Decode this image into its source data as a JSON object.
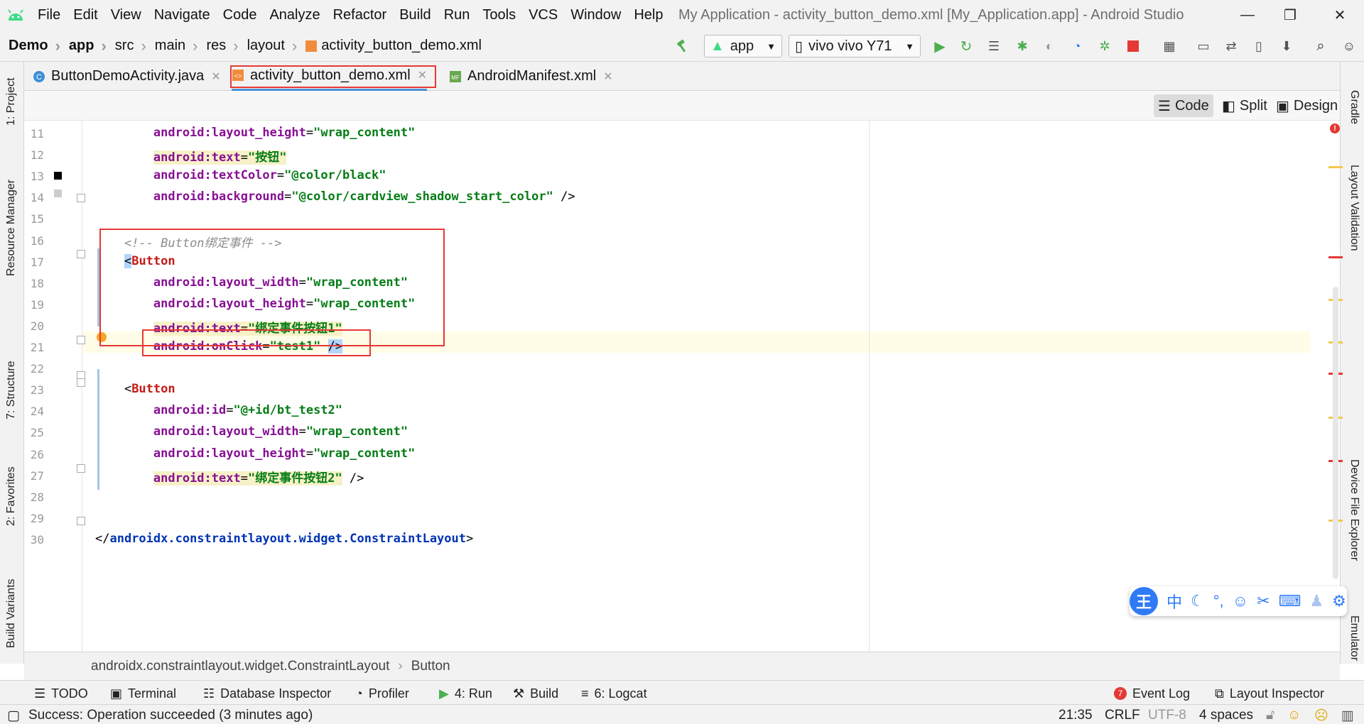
{
  "window": {
    "title": "My Application - activity_button_demo.xml [My_Application.app] - Android Studio"
  },
  "menu": [
    "File",
    "Edit",
    "View",
    "Navigate",
    "Code",
    "Analyze",
    "Refactor",
    "Build",
    "Run",
    "Tools",
    "VCS",
    "Window",
    "Help"
  ],
  "breadcrumb": [
    "Demo",
    "app",
    "src",
    "main",
    "res",
    "layout",
    "activity_button_demo.xml"
  ],
  "run_config": {
    "module": "app",
    "device": "vivo vivo Y71"
  },
  "tabs": [
    {
      "label": "ButtonDemoActivity.java",
      "active": false
    },
    {
      "label": "activity_button_demo.xml",
      "active": true
    },
    {
      "label": "AndroidManifest.xml",
      "active": false
    }
  ],
  "view_modes": [
    "Code",
    "Split",
    "Design"
  ],
  "left_tools": [
    "1: Project",
    "Resource Manager",
    "7: Structure",
    "2: Favorites",
    "Build Variants"
  ],
  "right_tools": [
    "Gradle",
    "Layout Validation",
    "Device File Explorer",
    "Emulator"
  ],
  "code": {
    "lines": [
      {
        "n": "11",
        "tokens": [
          [
            "",
            "        "
          ],
          [
            "attr",
            "android:layout_height"
          ],
          [
            "",
            "="
          ],
          [
            "val",
            "\"wrap_content\""
          ]
        ]
      },
      {
        "n": "12",
        "tokens": [
          [
            "",
            "        "
          ],
          [
            "attr hl-val",
            "android:text"
          ],
          [
            "hl-val",
            "="
          ],
          [
            "val hl-val",
            "\"按钮\""
          ]
        ]
      },
      {
        "n": "13",
        "tokens": [
          [
            "",
            "        "
          ],
          [
            "attr",
            "android:textColor"
          ],
          [
            "",
            "="
          ],
          [
            "val",
            "\"@color/black\""
          ]
        ]
      },
      {
        "n": "14",
        "tokens": [
          [
            "",
            "        "
          ],
          [
            "attr",
            "android:background"
          ],
          [
            "",
            "="
          ],
          [
            "val",
            "\"@color/cardview_shadow_start_color\""
          ],
          [
            "",
            " />"
          ]
        ]
      },
      {
        "n": "15",
        "tokens": []
      },
      {
        "n": "16",
        "tokens": [
          [
            "",
            "    "
          ],
          [
            "cmt",
            "<!-- Button绑定事件 -->"
          ]
        ]
      },
      {
        "n": "17",
        "tokens": [
          [
            "",
            "    "
          ],
          [
            "caret-hl",
            "<"
          ],
          [
            "tag",
            "Button"
          ]
        ]
      },
      {
        "n": "18",
        "tokens": [
          [
            "",
            "        "
          ],
          [
            "attr",
            "android:layout_width"
          ],
          [
            "",
            "="
          ],
          [
            "val",
            "\"wrap_content\""
          ]
        ]
      },
      {
        "n": "19",
        "tokens": [
          [
            "",
            "        "
          ],
          [
            "attr",
            "android:layout_height"
          ],
          [
            "",
            "="
          ],
          [
            "val",
            "\"wrap_content\""
          ]
        ]
      },
      {
        "n": "20",
        "tokens": [
          [
            "",
            "        "
          ],
          [
            "attr hl-val",
            "android:text"
          ],
          [
            "hl-val",
            "="
          ],
          [
            "val hl-val",
            "\"绑定事件按钮1\""
          ]
        ]
      },
      {
        "n": "21",
        "tokens": [
          [
            "",
            "        "
          ],
          [
            "attr",
            "android:onClick"
          ],
          [
            "",
            "="
          ],
          [
            "val",
            "\"test1\""
          ],
          [
            "",
            " "
          ],
          [
            "caret-hl",
            "/>"
          ]
        ]
      },
      {
        "n": "22",
        "tokens": []
      },
      {
        "n": "23",
        "tokens": [
          [
            "",
            "    <"
          ],
          [
            "tag",
            "Button"
          ]
        ]
      },
      {
        "n": "24",
        "tokens": [
          [
            "",
            "        "
          ],
          [
            "attr",
            "android:id"
          ],
          [
            "",
            "="
          ],
          [
            "val",
            "\"@+id/bt_test2\""
          ]
        ]
      },
      {
        "n": "25",
        "tokens": [
          [
            "",
            "        "
          ],
          [
            "attr",
            "android:layout_width"
          ],
          [
            "",
            "="
          ],
          [
            "val",
            "\"wrap_content\""
          ]
        ]
      },
      {
        "n": "26",
        "tokens": [
          [
            "",
            "        "
          ],
          [
            "attr",
            "android:layout_height"
          ],
          [
            "",
            "="
          ],
          [
            "val",
            "\"wrap_content\""
          ]
        ]
      },
      {
        "n": "27",
        "tokens": [
          [
            "",
            "        "
          ],
          [
            "attr hl-val",
            "android:text"
          ],
          [
            "hl-val",
            "="
          ],
          [
            "val hl-val",
            "\"绑定事件按钮2\""
          ],
          [
            "",
            " />"
          ]
        ]
      },
      {
        "n": "28",
        "tokens": []
      },
      {
        "n": "29",
        "tokens": []
      },
      {
        "n": "30",
        "tokens": [
          [
            "",
            "</"
          ],
          [
            "cls",
            "androidx.constraintlayout.widget.ConstraintLayout"
          ],
          [
            "",
            ">"
          ]
        ]
      }
    ]
  },
  "structure_path": [
    "androidx.constraintlayout.widget.ConstraintLayout",
    "Button"
  ],
  "bottom_tools": [
    "TODO",
    "Terminal",
    "Database Inspector",
    "Profiler",
    "4: Run",
    "Build",
    "6: Logcat"
  ],
  "bottom_right_tools": [
    "Event Log",
    "Layout Inspector"
  ],
  "event_log_count": "7",
  "status": {
    "message": "Success: Operation succeeded (3 minutes ago)",
    "position": "21:35",
    "line_sep": "CRLF",
    "encoding": "UTF-8",
    "indent": "4 spaces"
  },
  "ime": {
    "logo": "王",
    "mode": "中"
  },
  "colors": {
    "accent_red": "#e53935",
    "android_green": "#3ddc84",
    "run_green": "#4caf50"
  }
}
